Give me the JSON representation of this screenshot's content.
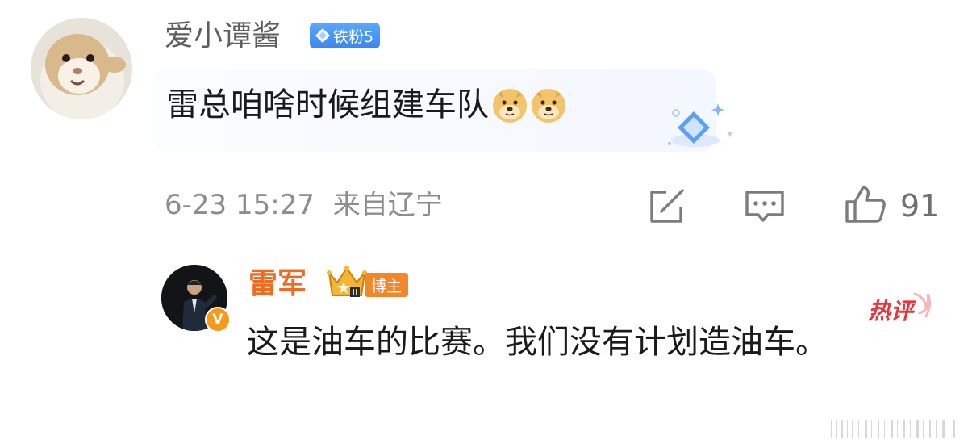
{
  "comment": {
    "username": "爱小谭酱",
    "fan_badge": "铁粉5",
    "text": "雷总咱啥时候组建车队",
    "emojis": [
      "doge-emoji",
      "doge-emoji"
    ],
    "timestamp": "6-23 15:27",
    "location": "来自辽宁",
    "like_count": "91"
  },
  "reply": {
    "username": "雷军",
    "role_badge": "博主",
    "hot_label": "热评",
    "text": "这是油车的比赛。我们没有计划造油车。"
  },
  "colors": {
    "reply_username": "#f06b20",
    "fan_badge": "#3c86ef",
    "blogger_badge": "#f4862a",
    "hot_label": "#e8343a"
  }
}
